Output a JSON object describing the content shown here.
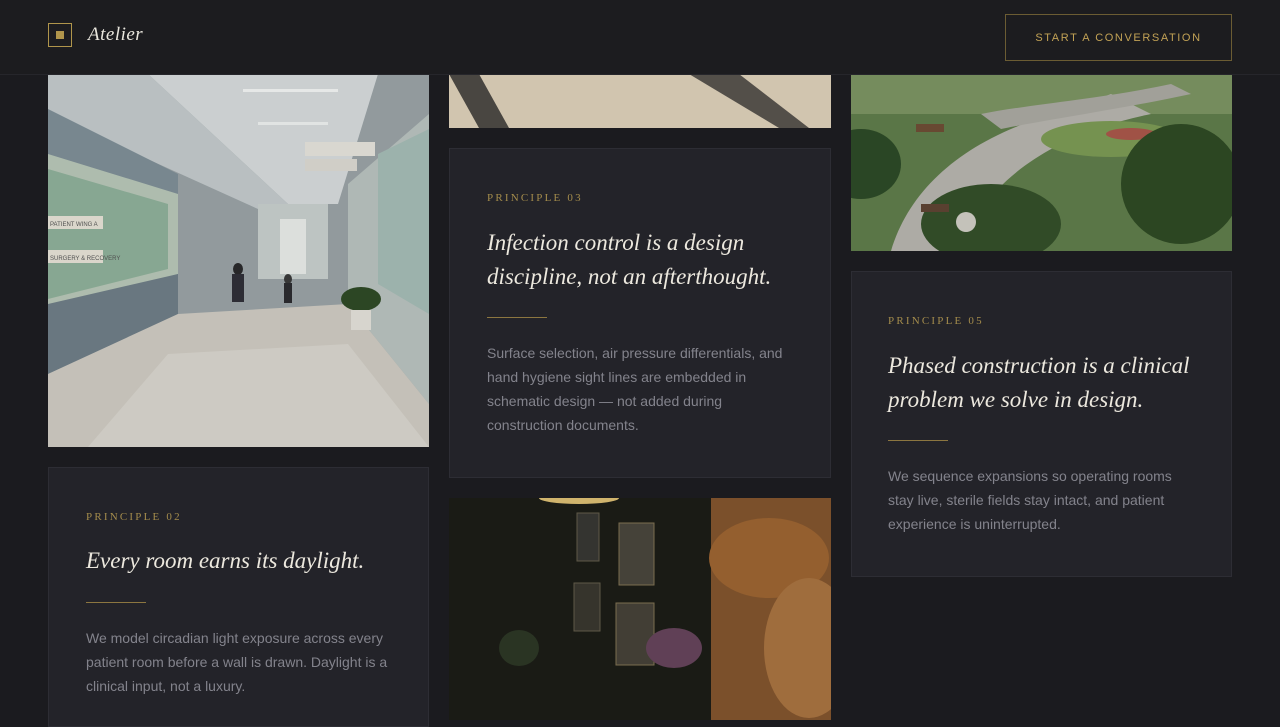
{
  "header": {
    "brand": "Atelier",
    "cta_label": "START A CONVERSATION"
  },
  "cards": [
    {
      "label": "PRINCIPLE 03",
      "title": "Infection control is a design discipline, not an afterthought.",
      "body": "Surface selection, air pressure differentials, and hand hygiene sight lines are embedded in schematic design — not added during construction documents."
    },
    {
      "label": "PRINCIPLE 05",
      "title": "Phased construction is a clinical problem we solve in design.",
      "body": "We sequence expansions so operating rooms stay live, sterile fields stay intact, and patient experience is uninterrupted."
    },
    {
      "label": "PRINCIPLE 02",
      "title": "Every room earns its daylight.",
      "body": "We model circadian light exposure across every patient room before a wall is drawn. Daylight is a clinical input, not a luxury."
    }
  ],
  "images": {
    "corridor_signs": [
      "PATIENT WING A",
      "SURGERY & RECOVERY"
    ]
  }
}
